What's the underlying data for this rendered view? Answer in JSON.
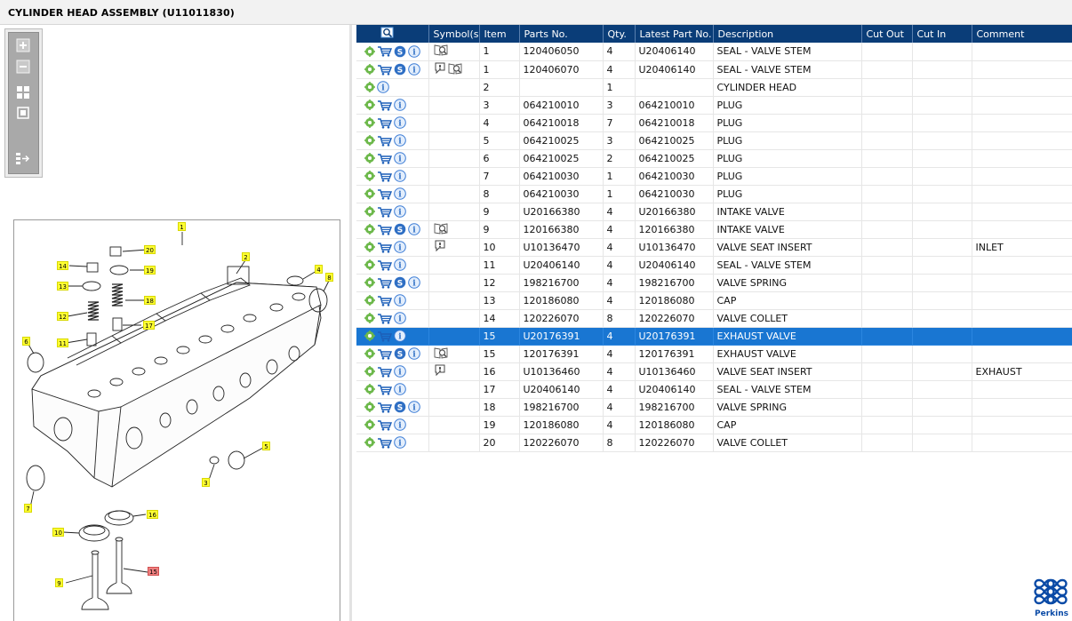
{
  "window": {
    "title": "CYLINDER HEAD ASSEMBLY (U11011830)"
  },
  "toolbar": {
    "buttons": [
      {
        "name": "zoom-in-button",
        "icon": "zoom-in-icon"
      },
      {
        "name": "zoom-out-button",
        "icon": "zoom-out-icon"
      },
      {
        "name": "fit-page-button",
        "icon": "fit-page-icon"
      },
      {
        "name": "actual-size-button",
        "icon": "actual-size-icon"
      },
      {
        "name": "collapse-panel-button",
        "icon": "collapse-panel-icon"
      }
    ]
  },
  "drawing": {
    "highlight_color": "#f08080",
    "callout_color": "#ffff33",
    "callouts": [
      "1",
      "20",
      "14",
      "19",
      "2",
      "4",
      "8",
      "13",
      "18",
      "12",
      "17",
      "11",
      "6",
      "5",
      "3",
      "7",
      "16",
      "10",
      "15",
      "9"
    ]
  },
  "grid": {
    "header_color": "#0a3d78",
    "selected_color": "#1976d2",
    "columns": [
      "",
      "Symbol(s)",
      "Item",
      "Parts No.",
      "Qty.",
      "Latest Part No.",
      "Description",
      "Cut Out",
      "Cut In",
      "Comment"
    ],
    "rows": [
      {
        "icons": [
          "gear",
          "cart",
          "s",
          "info"
        ],
        "symbols": [
          "book"
        ],
        "item": "1",
        "part": "120406050",
        "qty": "4",
        "latest": "U20406140",
        "desc": "SEAL - VALVE STEM",
        "cut_out": "",
        "cut_in": "",
        "comment": "",
        "selected": false
      },
      {
        "icons": [
          "gear",
          "cart",
          "s",
          "info"
        ],
        "symbols": [
          "note",
          "book"
        ],
        "item": "1",
        "part": "120406070",
        "qty": "4",
        "latest": "U20406140",
        "desc": "SEAL - VALVE STEM",
        "cut_out": "",
        "cut_in": "",
        "comment": "",
        "selected": false
      },
      {
        "icons": [
          "gear",
          "info"
        ],
        "symbols": [],
        "item": "2",
        "part": "",
        "qty": "1",
        "latest": "",
        "desc": "CYLINDER HEAD",
        "cut_out": "",
        "cut_in": "",
        "comment": "",
        "selected": false
      },
      {
        "icons": [
          "gear",
          "cart",
          "info"
        ],
        "symbols": [],
        "item": "3",
        "part": "064210010",
        "qty": "3",
        "latest": "064210010",
        "desc": "PLUG",
        "cut_out": "",
        "cut_in": "",
        "comment": "",
        "selected": false
      },
      {
        "icons": [
          "gear",
          "cart",
          "info"
        ],
        "symbols": [],
        "item": "4",
        "part": "064210018",
        "qty": "7",
        "latest": "064210018",
        "desc": "PLUG",
        "cut_out": "",
        "cut_in": "",
        "comment": "",
        "selected": false
      },
      {
        "icons": [
          "gear",
          "cart",
          "info"
        ],
        "symbols": [],
        "item": "5",
        "part": "064210025",
        "qty": "3",
        "latest": "064210025",
        "desc": "PLUG",
        "cut_out": "",
        "cut_in": "",
        "comment": "",
        "selected": false
      },
      {
        "icons": [
          "gear",
          "cart",
          "info"
        ],
        "symbols": [],
        "item": "6",
        "part": "064210025",
        "qty": "2",
        "latest": "064210025",
        "desc": "PLUG",
        "cut_out": "",
        "cut_in": "",
        "comment": "",
        "selected": false
      },
      {
        "icons": [
          "gear",
          "cart",
          "info"
        ],
        "symbols": [],
        "item": "7",
        "part": "064210030",
        "qty": "1",
        "latest": "064210030",
        "desc": "PLUG",
        "cut_out": "",
        "cut_in": "",
        "comment": "",
        "selected": false
      },
      {
        "icons": [
          "gear",
          "cart",
          "info"
        ],
        "symbols": [],
        "item": "8",
        "part": "064210030",
        "qty": "1",
        "latest": "064210030",
        "desc": "PLUG",
        "cut_out": "",
        "cut_in": "",
        "comment": "",
        "selected": false
      },
      {
        "icons": [
          "gear",
          "cart",
          "info"
        ],
        "symbols": [],
        "item": "9",
        "part": "U20166380",
        "qty": "4",
        "latest": "U20166380",
        "desc": "INTAKE VALVE",
        "cut_out": "",
        "cut_in": "",
        "comment": "",
        "selected": false
      },
      {
        "icons": [
          "gear",
          "cart",
          "s",
          "info"
        ],
        "symbols": [
          "book"
        ],
        "item": "9",
        "part": "120166380",
        "qty": "4",
        "latest": "120166380",
        "desc": "INTAKE VALVE",
        "cut_out": "",
        "cut_in": "",
        "comment": "",
        "selected": false
      },
      {
        "icons": [
          "gear",
          "cart",
          "info"
        ],
        "symbols": [
          "note"
        ],
        "item": "10",
        "part": "U10136470",
        "qty": "4",
        "latest": "U10136470",
        "desc": "VALVE SEAT INSERT",
        "cut_out": "",
        "cut_in": "",
        "comment": "INLET",
        "selected": false
      },
      {
        "icons": [
          "gear",
          "cart",
          "info"
        ],
        "symbols": [],
        "item": "11",
        "part": "U20406140",
        "qty": "4",
        "latest": "U20406140",
        "desc": "SEAL - VALVE STEM",
        "cut_out": "",
        "cut_in": "",
        "comment": "",
        "selected": false
      },
      {
        "icons": [
          "gear",
          "cart",
          "s",
          "info"
        ],
        "symbols": [],
        "item": "12",
        "part": "198216700",
        "qty": "4",
        "latest": "198216700",
        "desc": "VALVE SPRING",
        "cut_out": "",
        "cut_in": "",
        "comment": "",
        "selected": false
      },
      {
        "icons": [
          "gear",
          "cart",
          "info"
        ],
        "symbols": [],
        "item": "13",
        "part": "120186080",
        "qty": "4",
        "latest": "120186080",
        "desc": "CAP",
        "cut_out": "",
        "cut_in": "",
        "comment": "",
        "selected": false
      },
      {
        "icons": [
          "gear",
          "cart",
          "info"
        ],
        "symbols": [],
        "item": "14",
        "part": "120226070",
        "qty": "8",
        "latest": "120226070",
        "desc": "VALVE COLLET",
        "cut_out": "",
        "cut_in": "",
        "comment": "",
        "selected": false
      },
      {
        "icons": [
          "gear",
          "cart",
          "info"
        ],
        "symbols": [],
        "item": "15",
        "part": "U20176391",
        "qty": "4",
        "latest": "U20176391",
        "desc": "EXHAUST VALVE",
        "cut_out": "",
        "cut_in": "",
        "comment": "",
        "selected": true
      },
      {
        "icons": [
          "gear",
          "cart",
          "s",
          "info"
        ],
        "symbols": [
          "book"
        ],
        "item": "15",
        "part": "120176391",
        "qty": "4",
        "latest": "120176391",
        "desc": "EXHAUST VALVE",
        "cut_out": "",
        "cut_in": "",
        "comment": "",
        "selected": false
      },
      {
        "icons": [
          "gear",
          "cart",
          "info"
        ],
        "symbols": [
          "note"
        ],
        "item": "16",
        "part": "U10136460",
        "qty": "4",
        "latest": "U10136460",
        "desc": "VALVE SEAT INSERT",
        "cut_out": "",
        "cut_in": "",
        "comment": "EXHAUST",
        "selected": false
      },
      {
        "icons": [
          "gear",
          "cart",
          "info"
        ],
        "symbols": [],
        "item": "17",
        "part": "U20406140",
        "qty": "4",
        "latest": "U20406140",
        "desc": "SEAL - VALVE STEM",
        "cut_out": "",
        "cut_in": "",
        "comment": "",
        "selected": false
      },
      {
        "icons": [
          "gear",
          "cart",
          "s",
          "info"
        ],
        "symbols": [],
        "item": "18",
        "part": "198216700",
        "qty": "4",
        "latest": "198216700",
        "desc": "VALVE SPRING",
        "cut_out": "",
        "cut_in": "",
        "comment": "",
        "selected": false
      },
      {
        "icons": [
          "gear",
          "cart",
          "info"
        ],
        "symbols": [],
        "item": "19",
        "part": "120186080",
        "qty": "4",
        "latest": "120186080",
        "desc": "CAP",
        "cut_out": "",
        "cut_in": "",
        "comment": "",
        "selected": false
      },
      {
        "icons": [
          "gear",
          "cart",
          "info"
        ],
        "symbols": [],
        "item": "20",
        "part": "120226070",
        "qty": "8",
        "latest": "120226070",
        "desc": "VALVE COLLET",
        "cut_out": "",
        "cut_in": "",
        "comment": "",
        "selected": false
      }
    ]
  },
  "brand": {
    "name": "Perkins",
    "color": "#0a4aa6"
  }
}
